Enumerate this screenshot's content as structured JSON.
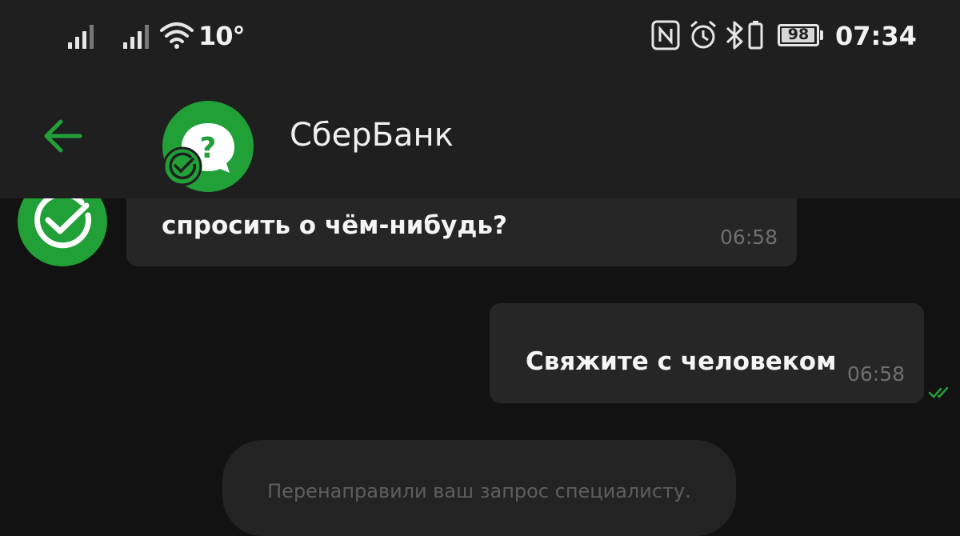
{
  "status_bar": {
    "temperature": "10°",
    "battery_level": 98,
    "battery_text": "98",
    "time": "07:34",
    "icons": [
      "signal-icon",
      "signal-icon",
      "wifi-icon",
      "nfc-icon",
      "alarm-icon",
      "bluetooth-icon",
      "battery-icon"
    ]
  },
  "header": {
    "title": "СберБанк",
    "back_icon": "arrow-left-icon",
    "avatar_icon": "question-bubble-icon",
    "badge_icon": "sber-check-icon"
  },
  "messages": [
    {
      "direction": "incoming",
      "sender_icon": "sber-logo-icon",
      "text": "спросить о чём-нибудь?",
      "time": "06:58"
    },
    {
      "direction": "outgoing",
      "text": "Свяжите с человеком",
      "time": "06:58",
      "status_icon": "double-check-icon"
    },
    {
      "direction": "system",
      "text": "Перенаправили ваш запрос специалисту."
    }
  ],
  "colors": {
    "background": "#121212",
    "bar": "#1f1f1f",
    "bubble": "#262626",
    "accent": "#21a038",
    "timestamp": "#6f6f6f"
  }
}
